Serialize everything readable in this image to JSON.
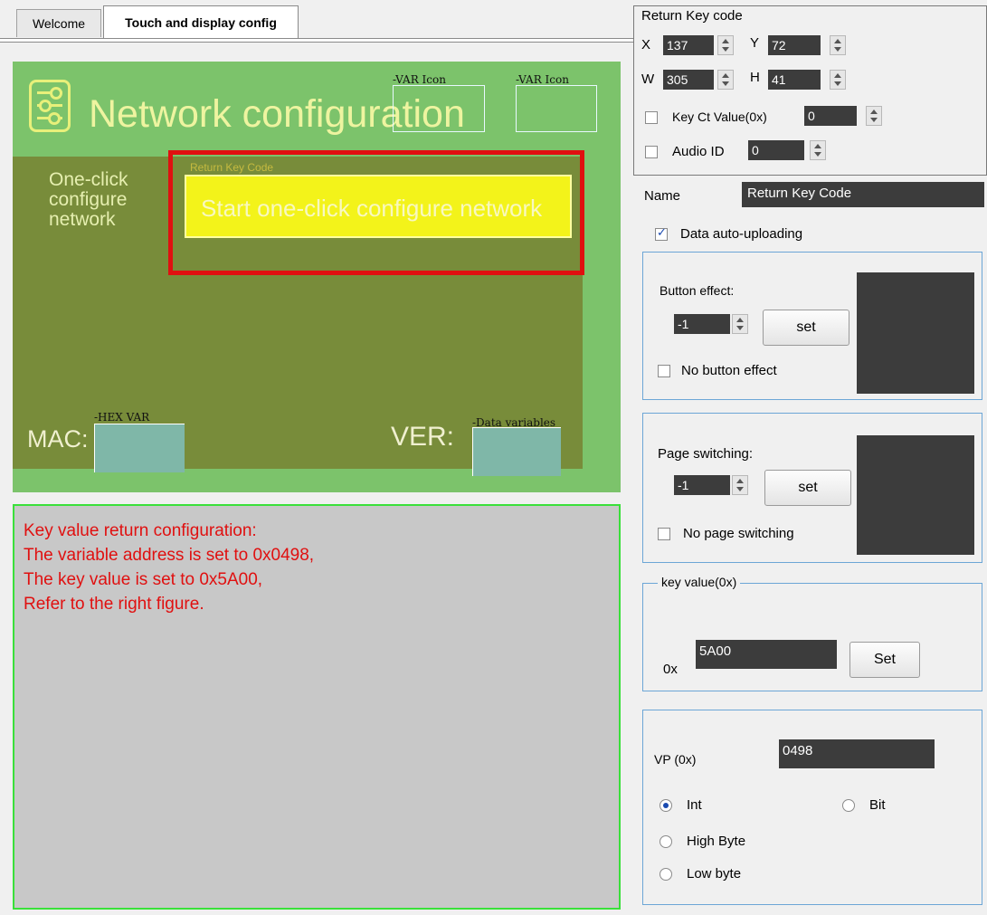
{
  "tabs": [
    {
      "label": "Welcome",
      "active": false
    },
    {
      "label": "Touch and display config",
      "active": true
    }
  ],
  "screen": {
    "title": "Network configuration",
    "var_icon_label_1": "-VAR Icon",
    "var_icon_label_2": "-VAR Icon",
    "one_click_text": "One-click configure network",
    "return_key_label": "Return Key Code",
    "button_text": "Start one-click configure network",
    "mac_label": "MAC:",
    "hex_var_label": "-HEX VAR",
    "ver_label": "VER:",
    "data_variables_label": "-Data variables",
    "colors": {
      "background": "#7cc36b",
      "dark_panel": "#788c3a",
      "button": "#f3f31a",
      "highlight": "#e01010"
    }
  },
  "note": {
    "lines": [
      "Key value return configuration:",
      "The variable address is set to 0x0498,",
      "The key value is set to 0x5A00,",
      "Refer to the right figure."
    ],
    "border_color": "#3ae03a",
    "text_color": "#e01010"
  },
  "panel": {
    "header": "Return Key code",
    "x_label": "X",
    "x_value": "137",
    "y_label": "Y",
    "y_value": "72",
    "w_label": "W",
    "w_value": "305",
    "h_label": "H",
    "h_value": "41",
    "key_ct_label": "Key Ct Value(0x)",
    "key_ct_value": "0",
    "key_ct_checked": false,
    "audio_label": "Audio ID",
    "audio_value": "0",
    "audio_checked": false,
    "name_label": "Name",
    "name_value": "Return Key Code",
    "auto_upload_label": "Data auto-uploading",
    "auto_upload_checked": true,
    "button_effect": {
      "label": "Button effect:",
      "value": "-1",
      "set_label": "set",
      "none_label": "No button effect",
      "none_checked": false
    },
    "page_switch": {
      "label": "Page switching:",
      "value": "-1",
      "set_label": "set",
      "none_label": "No page switching",
      "none_checked": false
    },
    "key_value": {
      "legend": "key value(0x)",
      "prefix": "0x",
      "value": "5A00",
      "set_label": "Set"
    },
    "vp": {
      "label": "VP (0x)",
      "value": "0498",
      "options": [
        {
          "label": "Int",
          "selected": true
        },
        {
          "label": "Bit",
          "selected": false
        },
        {
          "label": "High Byte",
          "selected": false
        },
        {
          "label": "Low byte",
          "selected": false
        }
      ]
    }
  }
}
